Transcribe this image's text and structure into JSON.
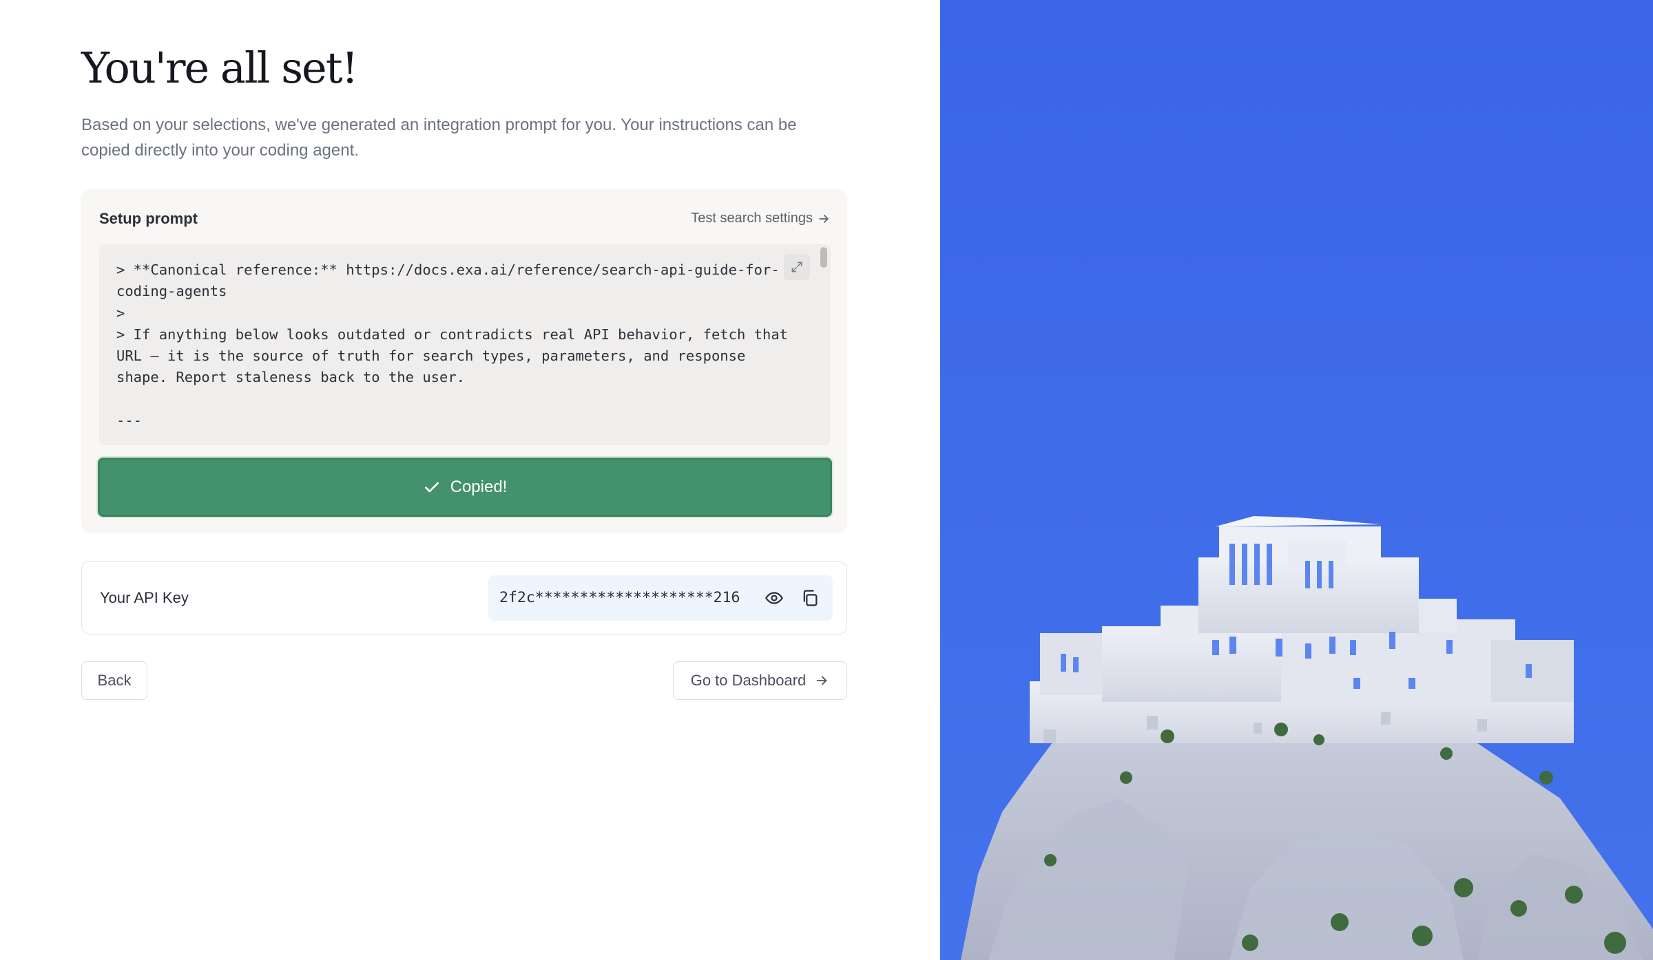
{
  "header": {
    "title": "You're all set!",
    "subtitle": "Based on your selections, we've generated an integration prompt for you. Your instructions can be copied directly into your coding agent."
  },
  "setup": {
    "label": "Setup prompt",
    "test_link": "Test search settings",
    "code": "> **Canonical reference:** https://docs.exa.ai/reference/search-api-guide-for-coding-agents\n>\n> If anything below looks outdated or contradicts real API behavior, fetch that URL — it is the source of truth for search types, parameters, and response shape. Report staleness back to the user.\n\n---",
    "copied_label": "Copied!"
  },
  "api_key": {
    "label": "Your API Key",
    "value": "2f2c********************216"
  },
  "nav": {
    "back_label": "Back",
    "dashboard_label": "Go to Dashboard"
  },
  "icons": {
    "arrow": "arrow-right-icon",
    "expand": "expand-icon",
    "check": "check-icon",
    "eye": "eye-icon",
    "copy": "copy-icon"
  },
  "colors": {
    "accent_green": "#44926b",
    "illustration_sky": "#3d6ae6",
    "key_field_bg": "#eff5fc"
  }
}
